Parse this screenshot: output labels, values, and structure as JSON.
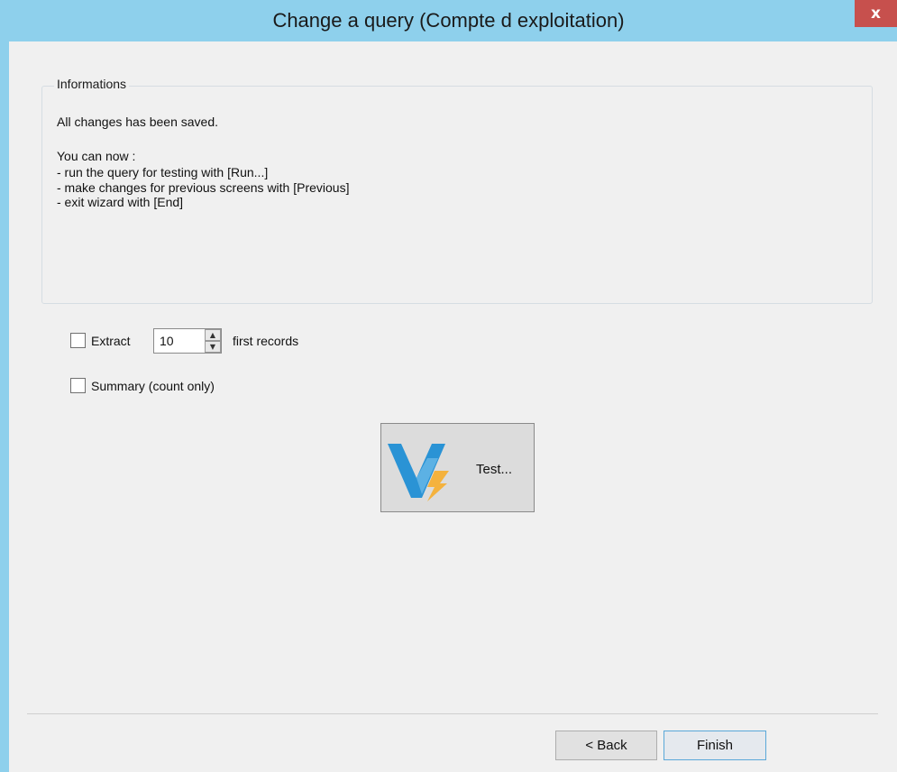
{
  "window": {
    "title": "Change a query (Compte d exploitation)",
    "close_glyph": "x",
    "accent_color": "#8ed0ec",
    "close_color": "#c7504d"
  },
  "informations": {
    "legend": "Informations",
    "lines": [
      "All changes has been saved.",
      "You can now :",
      "- run the query for testing with [Run...]",
      "- make changes for previous screens with [Previous]",
      "- exit wizard with [End]"
    ]
  },
  "options": {
    "extract_label": "Extract",
    "extract_checked": false,
    "extract_count": "10",
    "first_records_label": "first records",
    "summary_label": "Summary (count only)",
    "summary_checked": false
  },
  "test_button": {
    "label": "Test...",
    "icon": "v-lightning-logo-icon"
  },
  "footer": {
    "back_label": "< Back",
    "finish_label": "Finish"
  }
}
